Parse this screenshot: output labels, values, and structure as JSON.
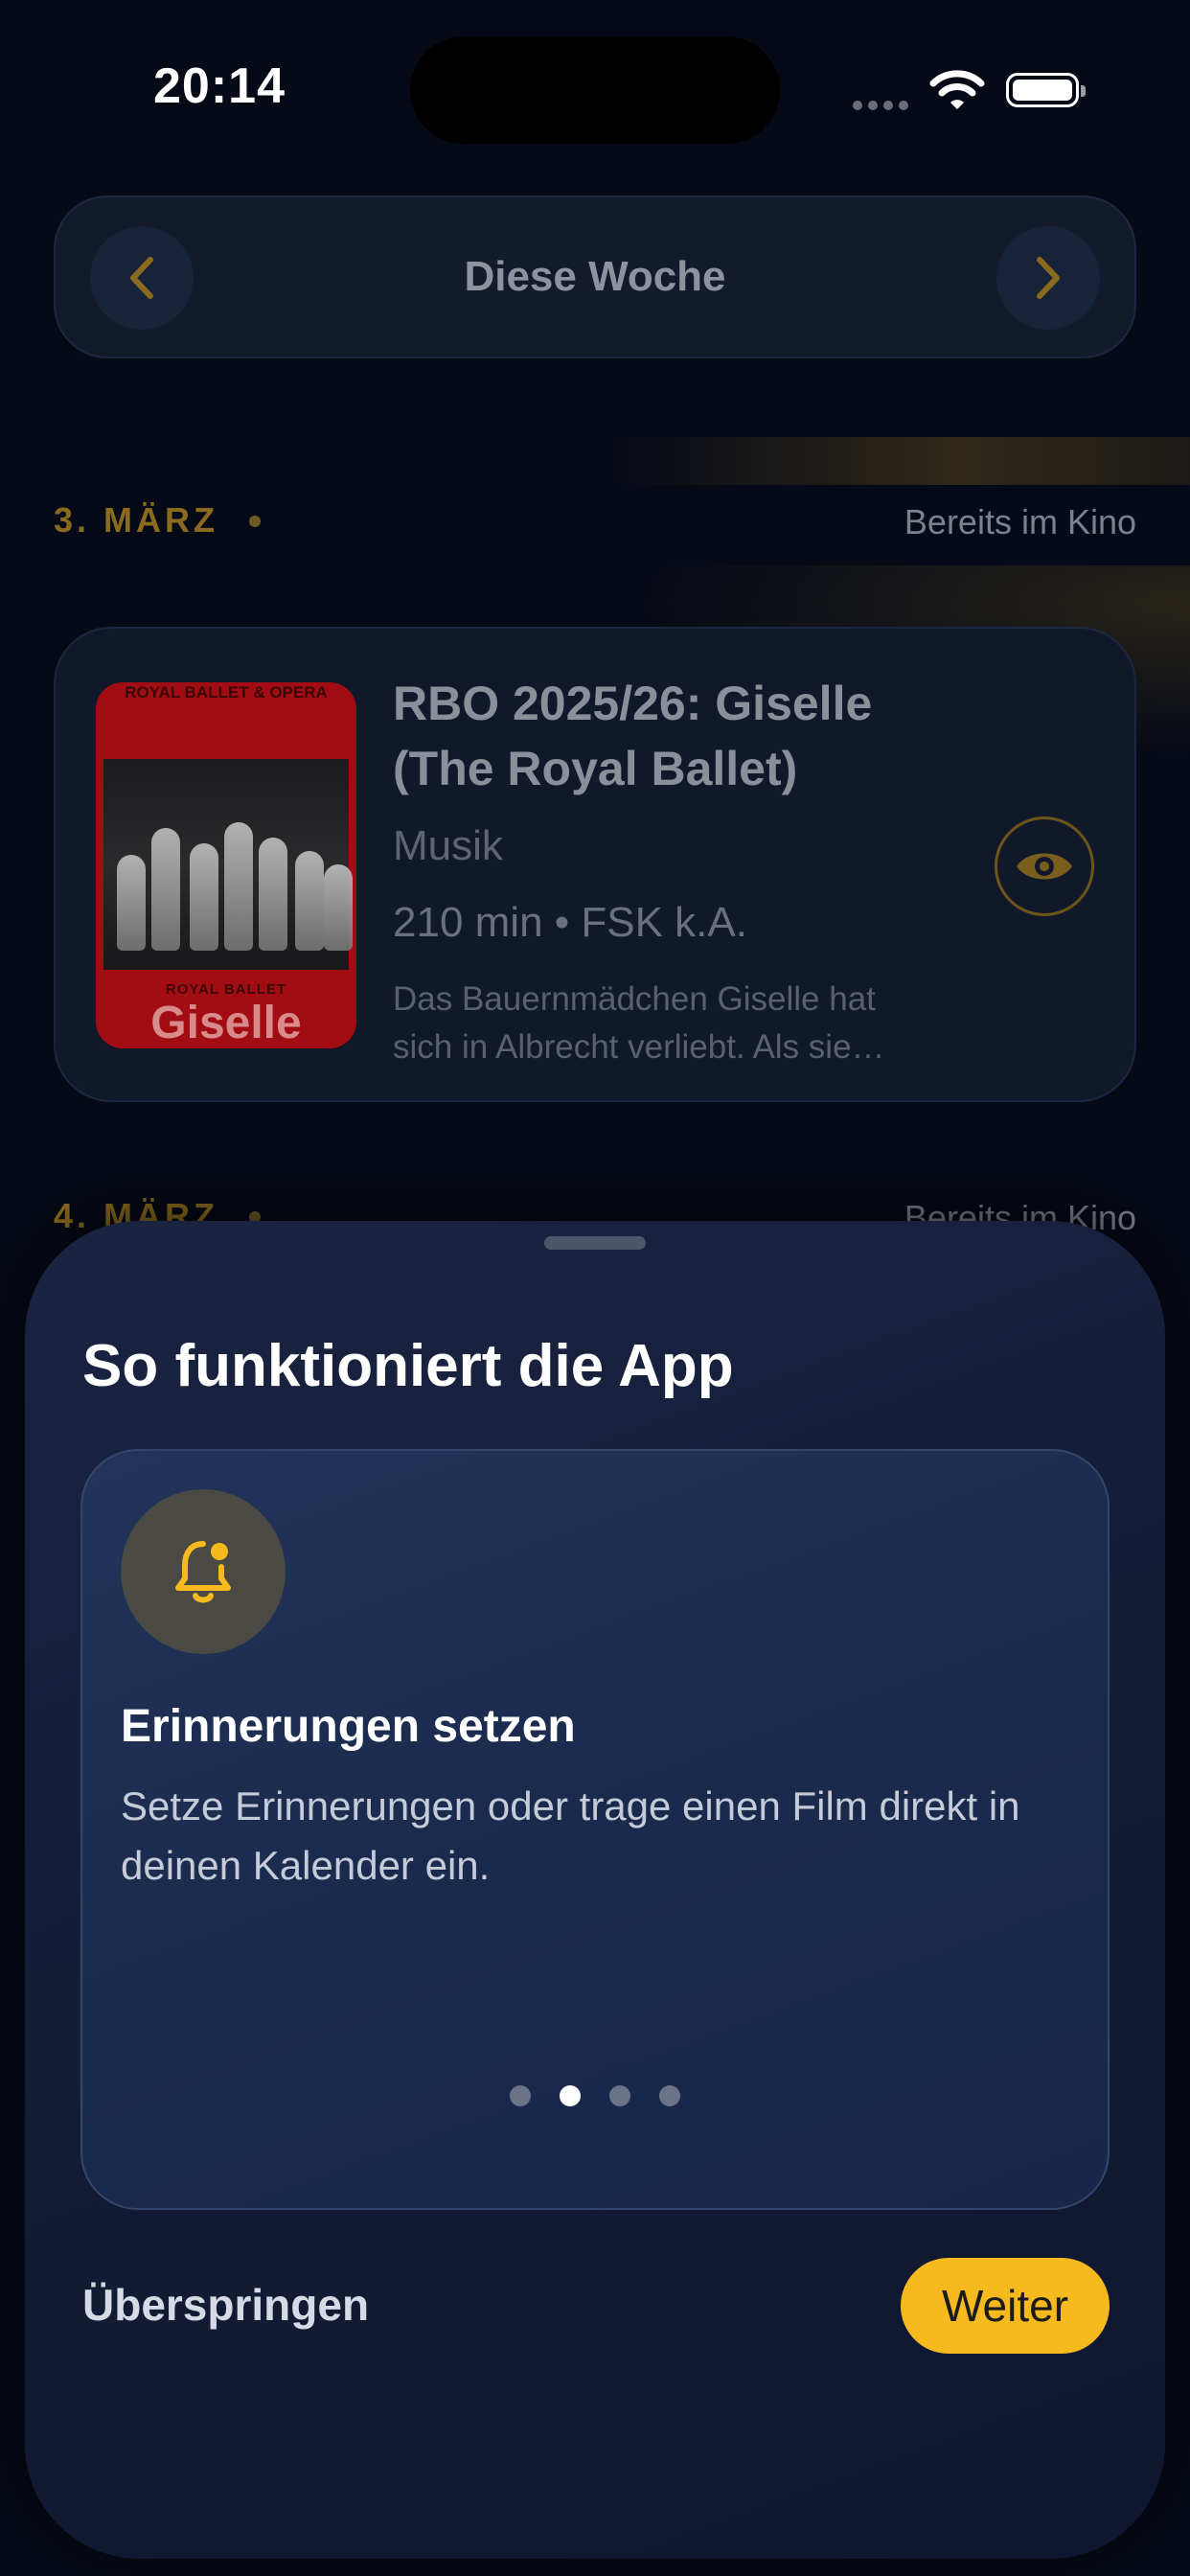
{
  "status_bar": {
    "time": "20:14",
    "icons": [
      "cellular-signal-icon",
      "wifi-icon",
      "battery-icon"
    ]
  },
  "week_selector": {
    "title": "Diese Woche",
    "prev_icon": "chevron-left-icon",
    "next_icon": "chevron-right-icon"
  },
  "sections": [
    {
      "date": "3. MÄRZ",
      "status": "Bereits im Kino"
    },
    {
      "date": "4. MÄRZ",
      "status": "Bereits im Kino"
    }
  ],
  "movie": {
    "title": "RBO 2025/26: Giselle (The Royal Ballet)",
    "genre": "Musik",
    "meta": "210 min • FSK k.A.",
    "description_line1": "Das Bauernmädchen Giselle hat",
    "description_line2": "sich in Albrecht verliebt. Als sie…",
    "poster": {
      "top_text": "ROYAL BALLET & OPERA",
      "company": "ROYAL BALLET",
      "title": "Giselle"
    },
    "watch_icon": "eye-icon"
  },
  "onboarding": {
    "title": "So funktioniert die App",
    "feature_icon": "bell-icon",
    "feature_heading": "Erinnerungen setzen",
    "feature_text": "Setze Erinnerungen oder trage einen Film direkt in deinen Kalender ein.",
    "page_count": 4,
    "active_page": 2,
    "skip_label": "Überspringen",
    "next_label": "Weiter"
  },
  "colors": {
    "accent": "#f6b91e",
    "background": "#060a16",
    "sheet": "#1a2442",
    "card": "#10182a"
  }
}
